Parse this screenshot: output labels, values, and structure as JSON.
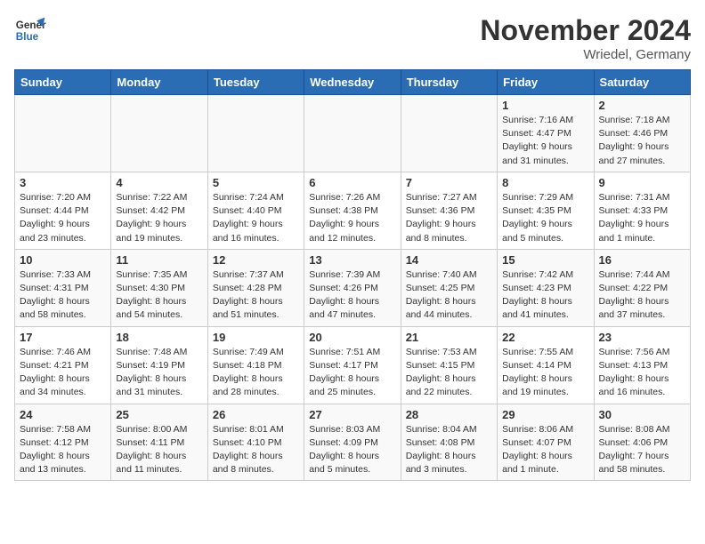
{
  "header": {
    "logo_line1": "General",
    "logo_line2": "Blue",
    "month": "November 2024",
    "location": "Wriedel, Germany"
  },
  "days_of_week": [
    "Sunday",
    "Monday",
    "Tuesday",
    "Wednesday",
    "Thursday",
    "Friday",
    "Saturday"
  ],
  "weeks": [
    [
      {
        "day": "",
        "detail": ""
      },
      {
        "day": "",
        "detail": ""
      },
      {
        "day": "",
        "detail": ""
      },
      {
        "day": "",
        "detail": ""
      },
      {
        "day": "",
        "detail": ""
      },
      {
        "day": "1",
        "detail": "Sunrise: 7:16 AM\nSunset: 4:47 PM\nDaylight: 9 hours\nand 31 minutes."
      },
      {
        "day": "2",
        "detail": "Sunrise: 7:18 AM\nSunset: 4:46 PM\nDaylight: 9 hours\nand 27 minutes."
      }
    ],
    [
      {
        "day": "3",
        "detail": "Sunrise: 7:20 AM\nSunset: 4:44 PM\nDaylight: 9 hours\nand 23 minutes."
      },
      {
        "day": "4",
        "detail": "Sunrise: 7:22 AM\nSunset: 4:42 PM\nDaylight: 9 hours\nand 19 minutes."
      },
      {
        "day": "5",
        "detail": "Sunrise: 7:24 AM\nSunset: 4:40 PM\nDaylight: 9 hours\nand 16 minutes."
      },
      {
        "day": "6",
        "detail": "Sunrise: 7:26 AM\nSunset: 4:38 PM\nDaylight: 9 hours\nand 12 minutes."
      },
      {
        "day": "7",
        "detail": "Sunrise: 7:27 AM\nSunset: 4:36 PM\nDaylight: 9 hours\nand 8 minutes."
      },
      {
        "day": "8",
        "detail": "Sunrise: 7:29 AM\nSunset: 4:35 PM\nDaylight: 9 hours\nand 5 minutes."
      },
      {
        "day": "9",
        "detail": "Sunrise: 7:31 AM\nSunset: 4:33 PM\nDaylight: 9 hours\nand 1 minute."
      }
    ],
    [
      {
        "day": "10",
        "detail": "Sunrise: 7:33 AM\nSunset: 4:31 PM\nDaylight: 8 hours\nand 58 minutes."
      },
      {
        "day": "11",
        "detail": "Sunrise: 7:35 AM\nSunset: 4:30 PM\nDaylight: 8 hours\nand 54 minutes."
      },
      {
        "day": "12",
        "detail": "Sunrise: 7:37 AM\nSunset: 4:28 PM\nDaylight: 8 hours\nand 51 minutes."
      },
      {
        "day": "13",
        "detail": "Sunrise: 7:39 AM\nSunset: 4:26 PM\nDaylight: 8 hours\nand 47 minutes."
      },
      {
        "day": "14",
        "detail": "Sunrise: 7:40 AM\nSunset: 4:25 PM\nDaylight: 8 hours\nand 44 minutes."
      },
      {
        "day": "15",
        "detail": "Sunrise: 7:42 AM\nSunset: 4:23 PM\nDaylight: 8 hours\nand 41 minutes."
      },
      {
        "day": "16",
        "detail": "Sunrise: 7:44 AM\nSunset: 4:22 PM\nDaylight: 8 hours\nand 37 minutes."
      }
    ],
    [
      {
        "day": "17",
        "detail": "Sunrise: 7:46 AM\nSunset: 4:21 PM\nDaylight: 8 hours\nand 34 minutes."
      },
      {
        "day": "18",
        "detail": "Sunrise: 7:48 AM\nSunset: 4:19 PM\nDaylight: 8 hours\nand 31 minutes."
      },
      {
        "day": "19",
        "detail": "Sunrise: 7:49 AM\nSunset: 4:18 PM\nDaylight: 8 hours\nand 28 minutes."
      },
      {
        "day": "20",
        "detail": "Sunrise: 7:51 AM\nSunset: 4:17 PM\nDaylight: 8 hours\nand 25 minutes."
      },
      {
        "day": "21",
        "detail": "Sunrise: 7:53 AM\nSunset: 4:15 PM\nDaylight: 8 hours\nand 22 minutes."
      },
      {
        "day": "22",
        "detail": "Sunrise: 7:55 AM\nSunset: 4:14 PM\nDaylight: 8 hours\nand 19 minutes."
      },
      {
        "day": "23",
        "detail": "Sunrise: 7:56 AM\nSunset: 4:13 PM\nDaylight: 8 hours\nand 16 minutes."
      }
    ],
    [
      {
        "day": "24",
        "detail": "Sunrise: 7:58 AM\nSunset: 4:12 PM\nDaylight: 8 hours\nand 13 minutes."
      },
      {
        "day": "25",
        "detail": "Sunrise: 8:00 AM\nSunset: 4:11 PM\nDaylight: 8 hours\nand 11 minutes."
      },
      {
        "day": "26",
        "detail": "Sunrise: 8:01 AM\nSunset: 4:10 PM\nDaylight: 8 hours\nand 8 minutes."
      },
      {
        "day": "27",
        "detail": "Sunrise: 8:03 AM\nSunset: 4:09 PM\nDaylight: 8 hours\nand 5 minutes."
      },
      {
        "day": "28",
        "detail": "Sunrise: 8:04 AM\nSunset: 4:08 PM\nDaylight: 8 hours\nand 3 minutes."
      },
      {
        "day": "29",
        "detail": "Sunrise: 8:06 AM\nSunset: 4:07 PM\nDaylight: 8 hours\nand 1 minute."
      },
      {
        "day": "30",
        "detail": "Sunrise: 8:08 AM\nSunset: 4:06 PM\nDaylight: 7 hours\nand 58 minutes."
      }
    ]
  ]
}
